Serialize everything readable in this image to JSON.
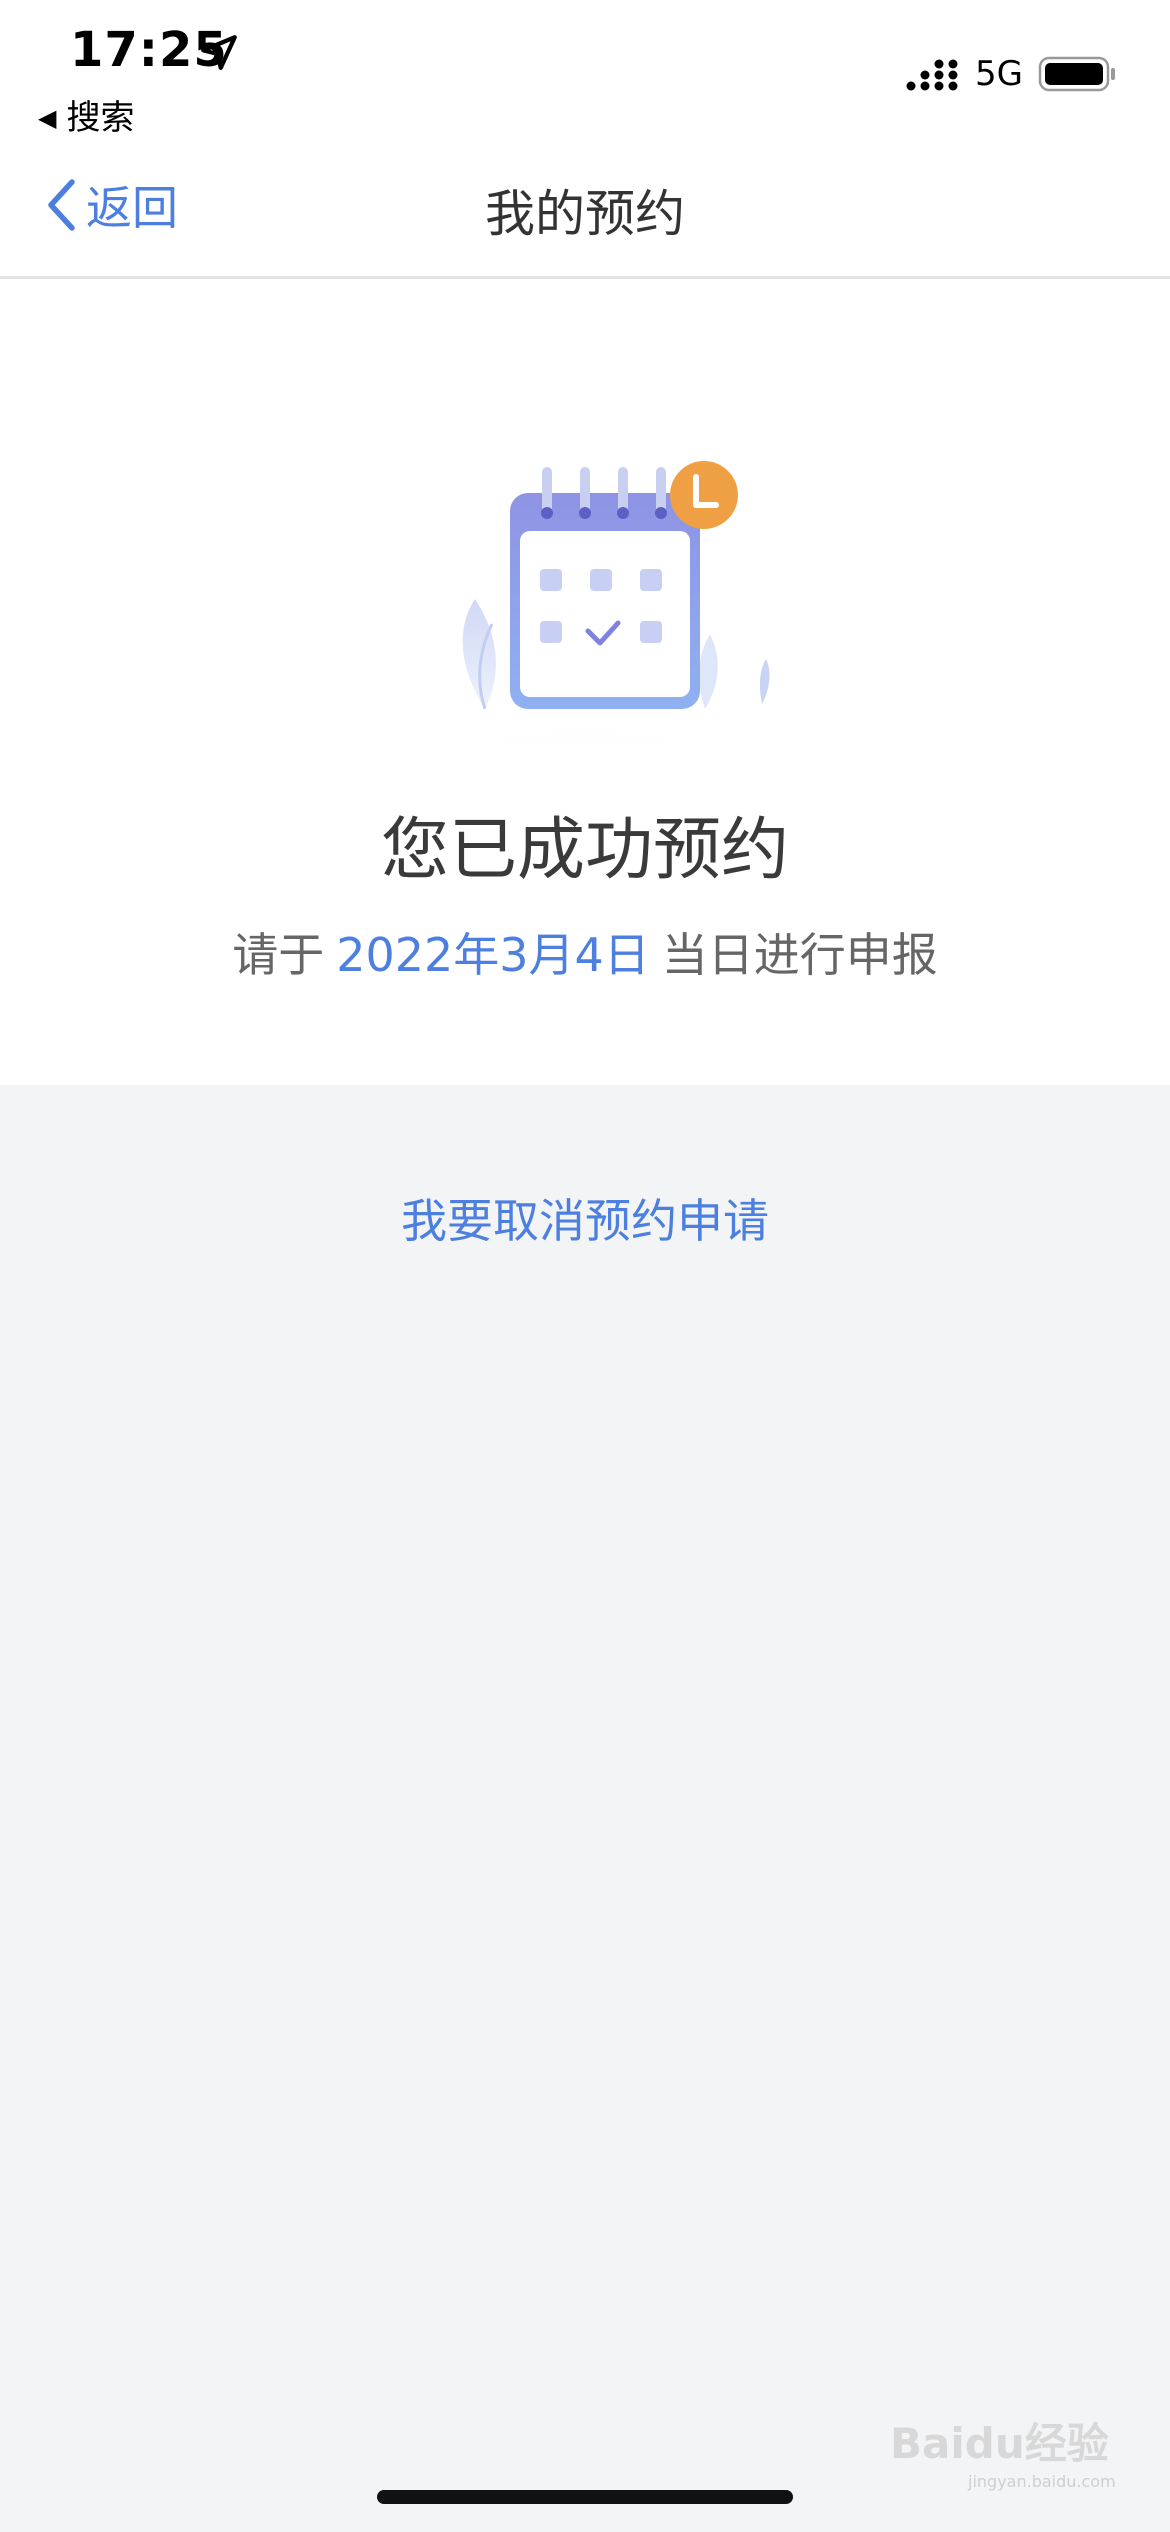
{
  "status_bar": {
    "time": "17:25",
    "back_app_label": "搜索",
    "network": "5G"
  },
  "nav": {
    "back_label": "返回",
    "title": "我的预约"
  },
  "result": {
    "title": "您已成功预约",
    "notice_prefix": "请于",
    "date": "2022年3月4日",
    "notice_suffix": "当日进行申报"
  },
  "actions": {
    "cancel_label": "我要取消预约申请"
  },
  "watermark": {
    "main": "Baidu经验",
    "sub": "jingyan.baidu.com"
  },
  "colors": {
    "accent": "#4d7fe0",
    "page_bg": "#f3f4f6",
    "clock_badge": "#f0a044"
  }
}
